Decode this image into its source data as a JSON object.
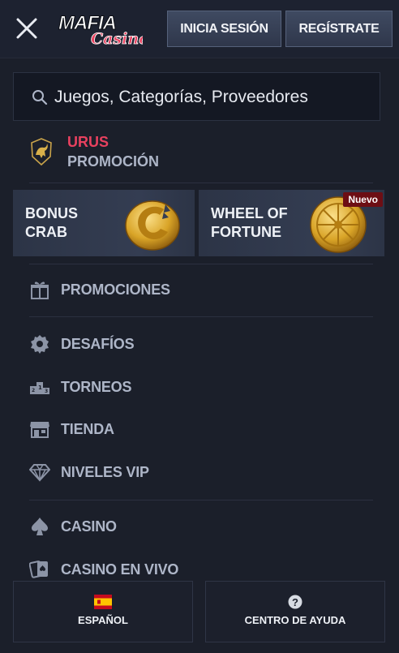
{
  "header": {
    "login_label": "INICIA SESIÓN",
    "register_label": "REGÍSTRATE",
    "logo_text_top": "Mafia",
    "logo_text_bottom": "Casino"
  },
  "search": {
    "placeholder": "Juegos, Categorías, Proveedores"
  },
  "promo": {
    "title": "URUS",
    "subtitle": "PROMOCIÓN"
  },
  "tiles": [
    {
      "label_line1": "BONUS",
      "label_line2": "CRAB"
    },
    {
      "label_line1": "WHEEL OF",
      "label_line2": "FORTUNE",
      "badge": "Nuevo"
    }
  ],
  "menu": {
    "promociones": "PROMOCIONES",
    "desafios": "DESAFÍOS",
    "torneos": "TORNEOS",
    "tienda": "TIENDA",
    "niveles_vip": "NIVELES VIP",
    "casino": "CASINO",
    "casino_en_vivo": "CASINO EN VIVO"
  },
  "footer": {
    "language_label": "ESPAÑOL",
    "help_label": "CENTRO DE AYUDA"
  },
  "colors": {
    "background": "#1b1f2a",
    "accent_red": "#e8415f",
    "text_muted": "#aeb6c8",
    "badge_bg": "#6d0e14",
    "gold": "#e0b23a"
  },
  "icons": {
    "close": "close-icon",
    "search": "search-icon",
    "promo": "bull-icon",
    "promociones": "gift-icon",
    "desafios": "badge-gear-icon",
    "torneos": "podium-icon",
    "tienda": "store-icon",
    "niveles_vip": "diamond-icon",
    "casino": "spade-icon",
    "casino_en_vivo": "cards-icon",
    "language": "spain-flag-icon",
    "help": "question-icon"
  }
}
